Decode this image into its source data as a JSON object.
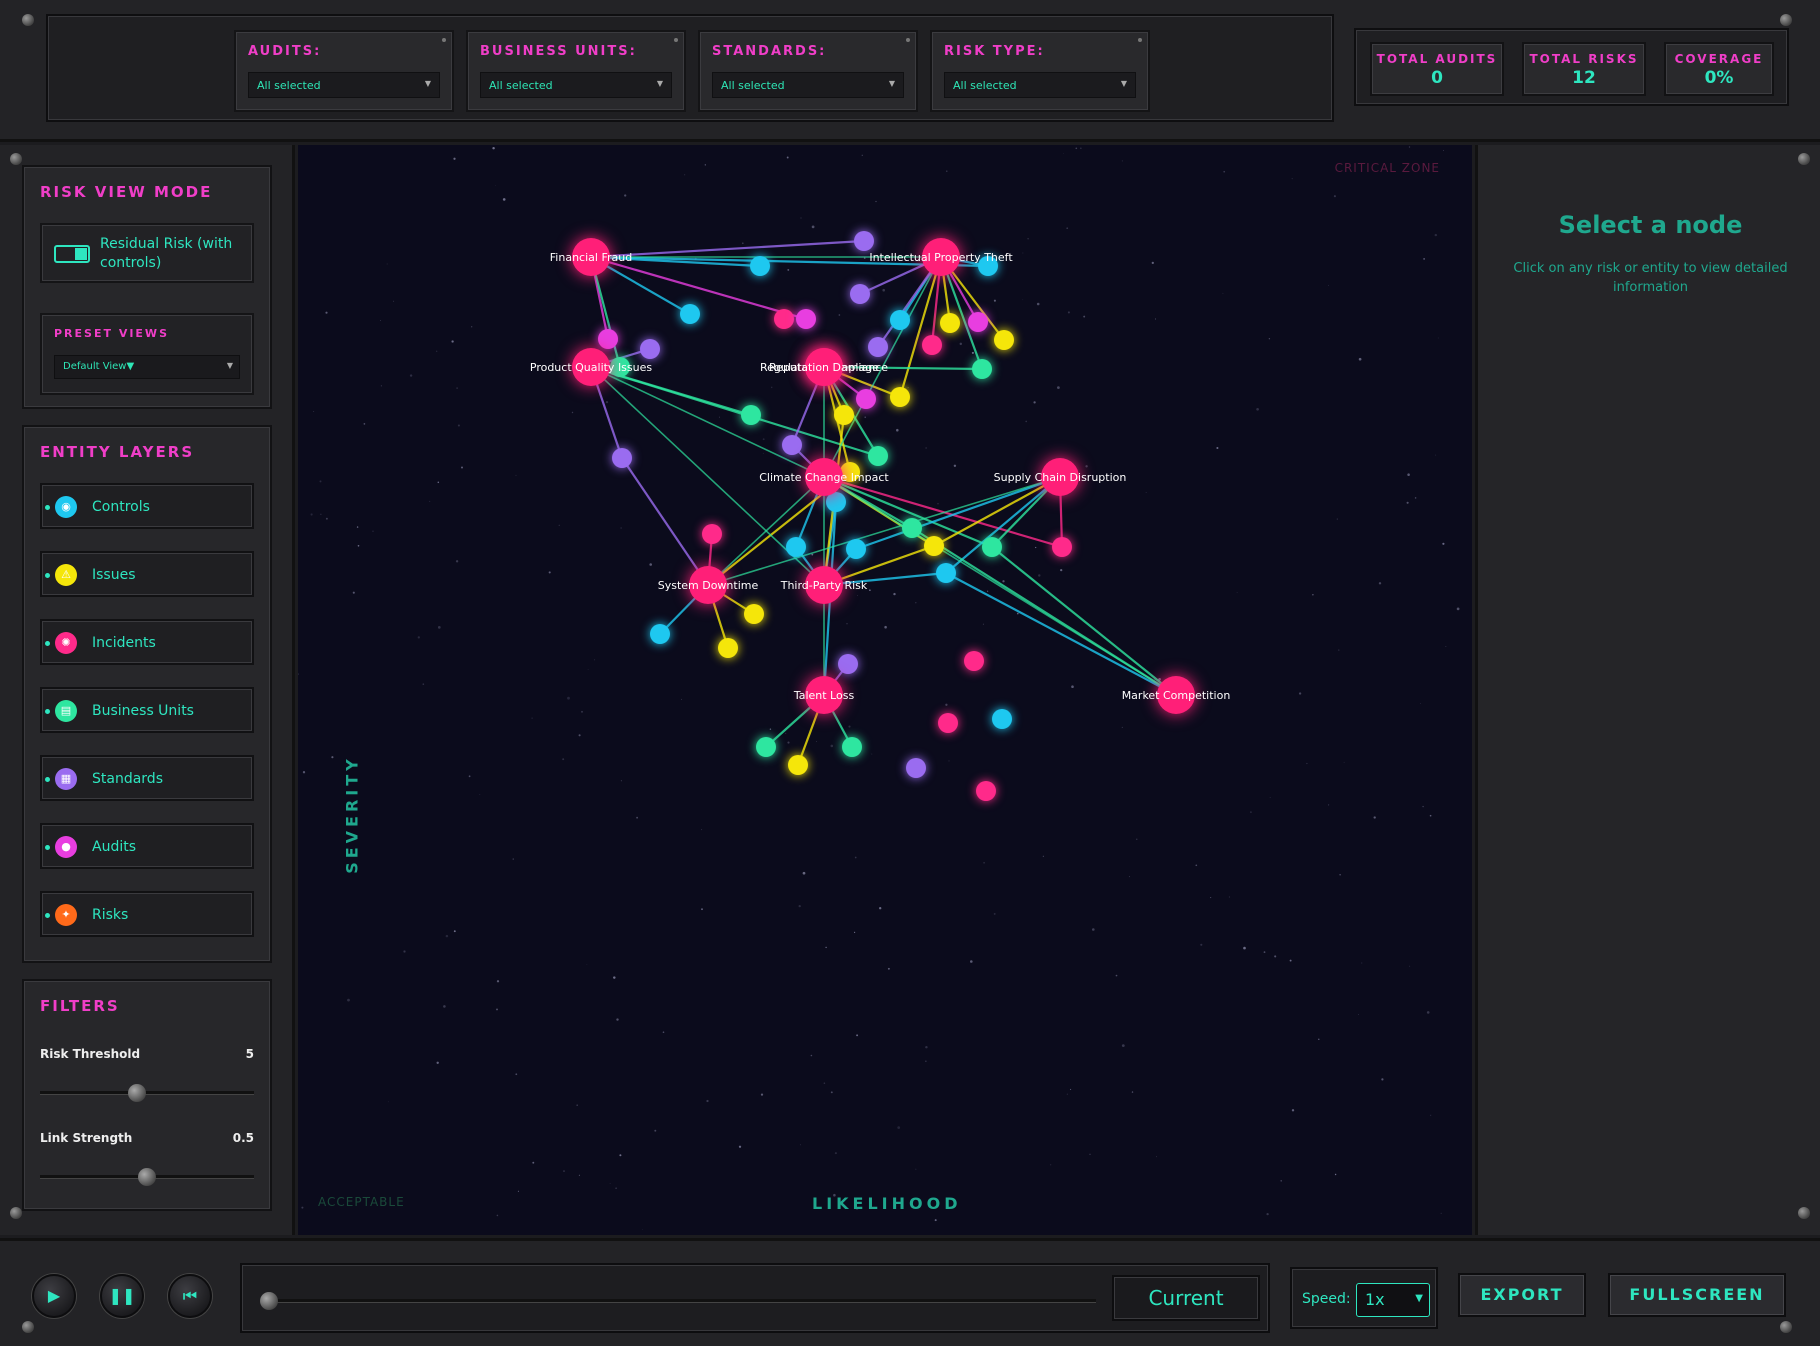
{
  "filters": [
    {
      "label": "AUDITS:",
      "value": "All selected"
    },
    {
      "label": "BUSINESS UNITS:",
      "value": "All selected"
    },
    {
      "label": "STANDARDS:",
      "value": "All selected"
    },
    {
      "label": "RISK TYPE:",
      "value": "All selected"
    }
  ],
  "stats": {
    "audits_label": "TOTAL AUDITS",
    "audits_value": "0",
    "risks_label": "TOTAL RISKS",
    "risks_value": "12",
    "coverage_label": "COVERAGE",
    "coverage_value": "0%"
  },
  "sidebar": {
    "mode_title": "RISK VIEW MODE",
    "mode_toggle_label": "Residual Risk (with controls)",
    "preset_title": "PRESET VIEWS",
    "preset_value": "Default View▼",
    "layers_title": "ENTITY LAYERS",
    "layers": [
      {
        "label": "Controls",
        "icon": "control-icon",
        "color": "#1ec8f0"
      },
      {
        "label": "Issues",
        "icon": "warning-icon",
        "color": "#f5e60a"
      },
      {
        "label": "Incidents",
        "icon": "siren-icon",
        "color": "#ff2a8a"
      },
      {
        "label": "Business Units",
        "icon": "building-icon",
        "color": "#2ee6a0"
      },
      {
        "label": "Standards",
        "icon": "document-icon",
        "color": "#9a6cf0"
      },
      {
        "label": "Audits",
        "icon": "magnifier-icon",
        "color": "#e83ee0"
      },
      {
        "label": "Risks",
        "icon": "risk-icon",
        "color": "#ff6a1a"
      }
    ],
    "filters_title": "FILTERS",
    "risk_threshold_label": "Risk Threshold",
    "risk_threshold_value": "5",
    "risk_threshold_level": 0.45,
    "link_strength_label": "Link Strength",
    "link_strength_value": "0.5",
    "link_strength_level": 0.5
  },
  "graph": {
    "critical_label": "CRITICAL ZONE",
    "acceptable_label": "ACCEPTABLE",
    "x_axis_label": "LIKELIHOOD",
    "y_axis_label": "SEVERITY",
    "risk_labels": [
      "Financial Fraud",
      "Intellectual Property Theft",
      "Product Quality Issues",
      "Regulatory Compliance",
      "Reputation Damage",
      "Climate Change Impact",
      "Supply Chain Disruption",
      "System Downtime",
      "Third-Party Risk",
      "Talent Loss",
      "Market Competition"
    ]
  },
  "details": {
    "title": "Select a node",
    "description": "Click on any risk or entity to view detailed information"
  },
  "playback": {
    "current_label": "Current",
    "speed_label": "Speed:",
    "speed_value": "1x",
    "export_label": "EXPORT",
    "fullscreen_label": "FULLSCREEN"
  },
  "colors": {
    "accent": "#2ee6c0",
    "title_pink": "#f03ec8",
    "risk_node": "#ff1f78",
    "control": "#1ec8f0",
    "issue": "#f5e60a",
    "incident": "#ff2a8a",
    "business_unit": "#2ee6a0",
    "standard": "#9a6cf0",
    "audit": "#e83ee0"
  }
}
